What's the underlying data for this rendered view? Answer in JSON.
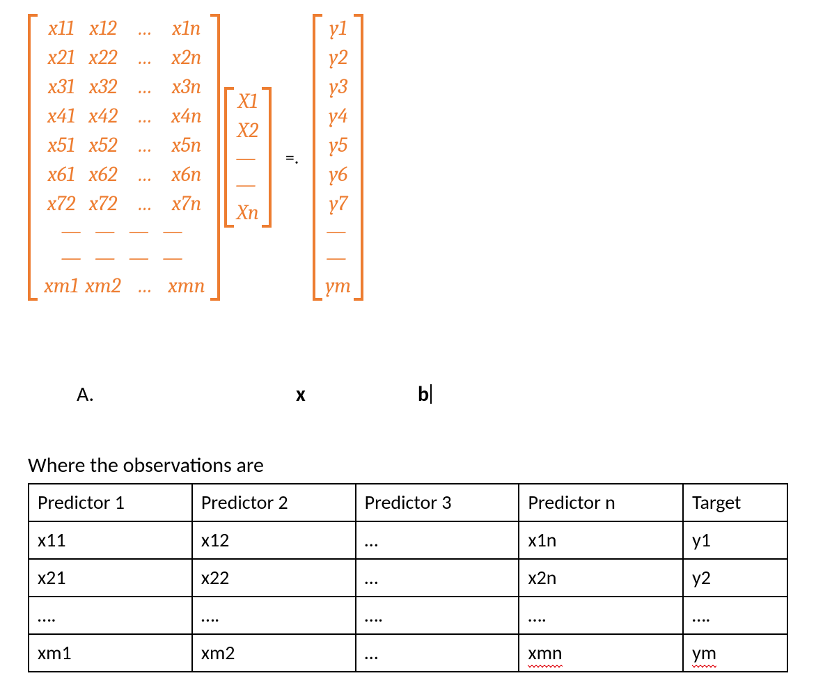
{
  "equation": {
    "A": {
      "rows": [
        [
          "x11",
          "x12",
          "…",
          "x1n"
        ],
        [
          "x21",
          "x22",
          "…",
          "x2n"
        ],
        [
          "x31",
          "x32",
          "…",
          "x3n"
        ],
        [
          "x41",
          "x42",
          "…",
          "x4n"
        ],
        [
          "x51",
          "x52",
          "…",
          "x5n"
        ],
        [
          "x61",
          "x62",
          "…",
          "x6n"
        ],
        [
          "x72",
          "x72",
          "…",
          "x7n"
        ]
      ],
      "dash1": "— —    — —",
      "dash2": "— —    — —",
      "last": [
        "xm1",
        "xm2",
        "…",
        "xmn"
      ]
    },
    "X": {
      "r1": "X1",
      "r2": "X2",
      "d1": "—",
      "d2": "—",
      "rn": "Xn"
    },
    "eq": "=.",
    "B": {
      "r": [
        "y1",
        "y2",
        "y3",
        "y4",
        "y5",
        "y6",
        "y7"
      ],
      "d1": "—",
      "d2": "—",
      "rm": "ym"
    },
    "labels": {
      "A": "A.",
      "x": "x",
      "b": "b"
    }
  },
  "body_text": "Where the observations are",
  "table": {
    "header": [
      "Predictor 1",
      "Predictor 2",
      "Predictor 3",
      "Predictor n",
      "Target"
    ],
    "rows": [
      [
        "x11",
        "x12",
        "…",
        "x1n",
        "y1"
      ],
      [
        "x21",
        "x22",
        "…",
        "x2n",
        "y2"
      ],
      [
        "….",
        "….",
        "….",
        "….",
        "…."
      ],
      [
        "xm1",
        "xm2",
        "…",
        "xmn",
        "ym"
      ]
    ]
  }
}
